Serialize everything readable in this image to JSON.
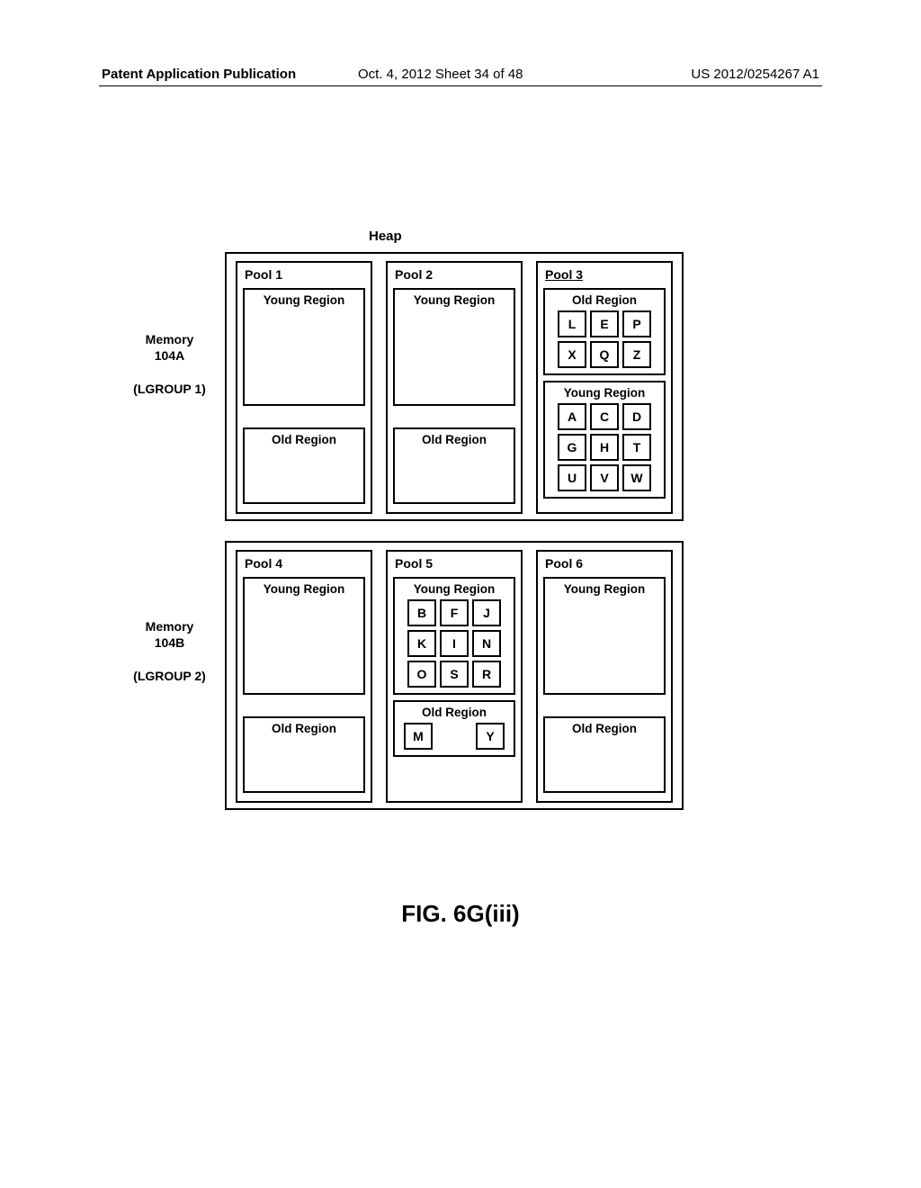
{
  "header": {
    "left": "Patent Application Publication",
    "mid": "Oct. 4, 2012   Sheet 34 of 48",
    "right": "US 2012/0254267 A1"
  },
  "heap_label": "Heap",
  "figure_label": "FIG. 6G(iii)",
  "mem1": {
    "label_line1": "Memory",
    "label_line2": "104A",
    "label_line3": "(LGROUP 1)"
  },
  "mem2": {
    "label_line1": "Memory",
    "label_line2": "104B",
    "label_line3": "(LGROUP 2)"
  },
  "pools": {
    "p1": {
      "title": "Pool 1",
      "young": "Young Region",
      "old": "Old Region"
    },
    "p2": {
      "title": "Pool 2",
      "young": "Young Region",
      "old": "Old Region"
    },
    "p3": {
      "title": "Pool 3",
      "young": "Young Region",
      "old": "Old Region"
    },
    "p4": {
      "title": "Pool 4",
      "young": "Young Region",
      "old": "Old Region"
    },
    "p5": {
      "title": "Pool 5",
      "young": "Young Region",
      "old": "Old Region"
    },
    "p6": {
      "title": "Pool 6",
      "young": "Young Region",
      "old": "Old Region"
    }
  },
  "cells": {
    "p3_old": [
      [
        "L",
        "E",
        "P"
      ],
      [
        "X",
        "Q",
        "Z"
      ]
    ],
    "p3_young": [
      [
        "A",
        "C",
        "D"
      ],
      [
        "G",
        "H",
        "T"
      ],
      [
        "U",
        "V",
        "W"
      ]
    ],
    "p5_young": [
      [
        "B",
        "F",
        "J"
      ],
      [
        "K",
        "I",
        "N"
      ],
      [
        "O",
        "S",
        "R"
      ]
    ],
    "p5_old": [
      "M",
      "Y"
    ]
  }
}
